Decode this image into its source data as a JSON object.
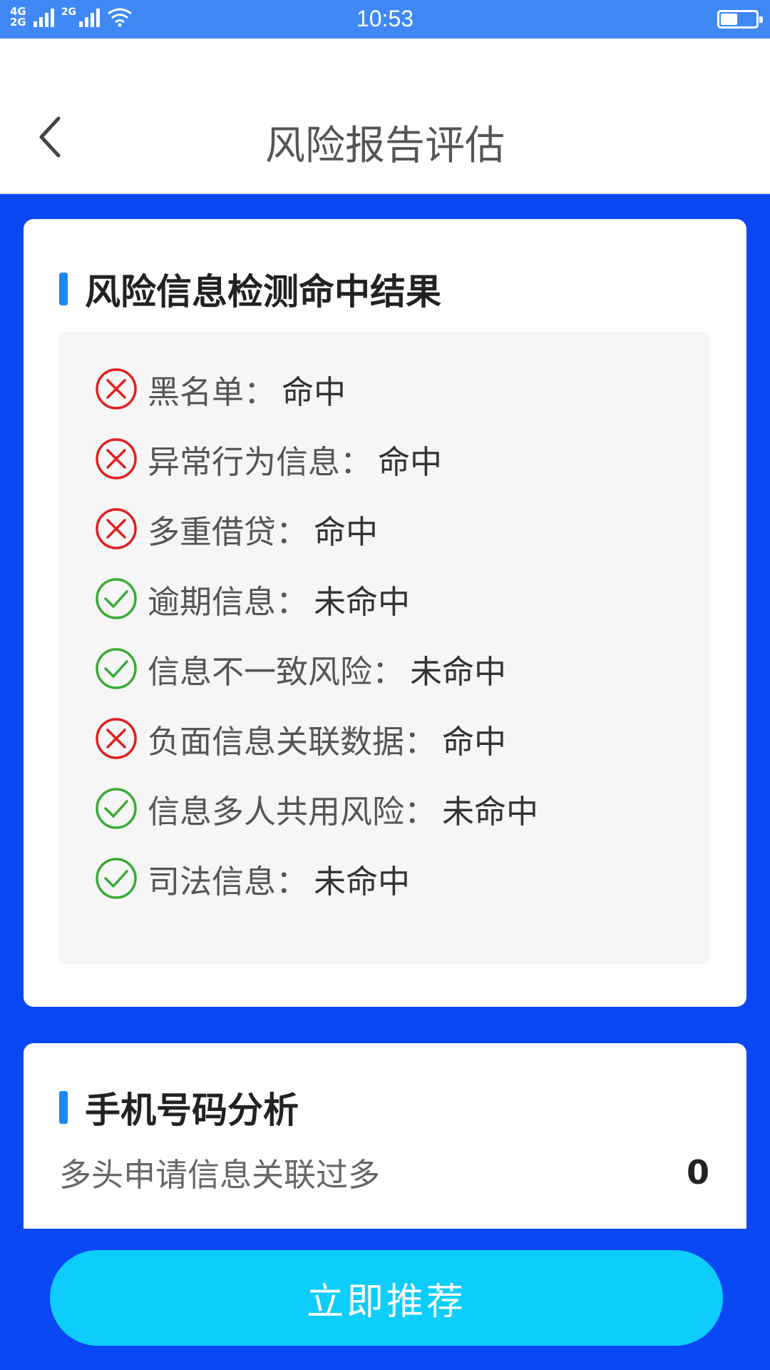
{
  "status_bar": {
    "network_primary": "4G",
    "network_secondary": "2G",
    "network_secondary_2": "2G",
    "time": "10:53",
    "battery_level": 0.45
  },
  "header": {
    "title": "风险报告评估",
    "back_icon": "chevron-left-icon"
  },
  "risk_section": {
    "title": "风险信息检测命中结果",
    "separator": "：",
    "items": [
      {
        "label": "黑名单",
        "value": "命中",
        "status": "hit",
        "icon": "cross-circle-icon",
        "color": "#e02020"
      },
      {
        "label": "异常行为信息",
        "value": "命中",
        "status": "hit",
        "icon": "cross-circle-icon",
        "color": "#e02020"
      },
      {
        "label": "多重借贷",
        "value": "命中",
        "status": "hit",
        "icon": "cross-circle-icon",
        "color": "#e02020"
      },
      {
        "label": "逾期信息",
        "value": "未命中",
        "status": "miss",
        "icon": "check-circle-icon",
        "color": "#3aaa35"
      },
      {
        "label": "信息不一致风险",
        "value": "未命中",
        "status": "miss",
        "icon": "check-circle-icon",
        "color": "#3aaa35"
      },
      {
        "label": "负面信息关联数据",
        "value": "命中",
        "status": "hit",
        "icon": "cross-circle-icon",
        "color": "#e02020"
      },
      {
        "label": "信息多人共用风险",
        "value": "未命中",
        "status": "miss",
        "icon": "check-circle-icon",
        "color": "#3aaa35"
      },
      {
        "label": "司法信息",
        "value": "未命中",
        "status": "miss",
        "icon": "check-circle-icon",
        "color": "#3aaa35"
      }
    ]
  },
  "phone_section": {
    "title": "手机号码分析",
    "rows": [
      {
        "label": "多头申请信息关联过多",
        "value": "0"
      }
    ]
  },
  "cta": {
    "label": "立即推荐"
  },
  "colors": {
    "background": "#0a47f5",
    "status_bar": "#3f88f6",
    "accent_bar": "#1e88f0",
    "button": "#0ccdfb",
    "hit": "#e02020",
    "miss": "#3aaa35"
  }
}
